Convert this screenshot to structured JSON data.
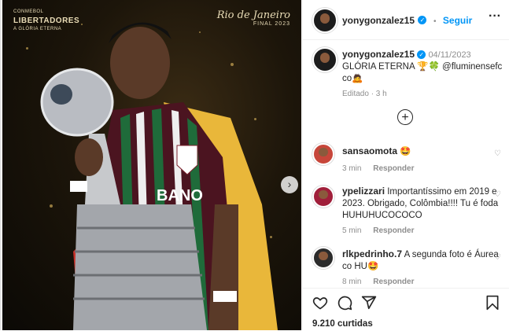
{
  "photo": {
    "logo_top": "CONMEBOL",
    "logo_main": "LIBERTADORES",
    "logo_sub": "A GLÓRIA ETERNA",
    "rio_title": "Rio de Janeiro",
    "rio_sub": "FINAL 2023",
    "jersey_sponsor": "BANO",
    "next_arrow": "›"
  },
  "header": {
    "username": "yonygonzalez15",
    "separator": "•",
    "follow_label": "Seguir",
    "more_icon": "···"
  },
  "caption": {
    "username": "yonygonzalez15",
    "date": "04/11/2023",
    "text": "GLÓRIA ETERNA 🏆🍀 @fluminensefc co🙇",
    "meta": "Editado · 3 h"
  },
  "load_more_icon": "⊕",
  "comments": [
    {
      "username": "sansaomota",
      "text": "🤩",
      "time": "3 min",
      "reply": "Responder"
    },
    {
      "username": "ypelizzari",
      "text": "Importantíssimo em 2019 e 2023. Obrigado, Colômbia!!!! Tu é foda HUHUHUCOCOCO",
      "time": "5 min",
      "reply": "Responder"
    },
    {
      "username": "rlkpedrinho.7",
      "text": "A segunda foto é Áurea co HU🤩",
      "time": "8 min",
      "reply": "Responder"
    }
  ],
  "footer": {
    "likes": "9.210 curtidas"
  },
  "colors": {
    "accent": "#0095f6",
    "text": "#262626",
    "muted": "#8e8e8e"
  }
}
